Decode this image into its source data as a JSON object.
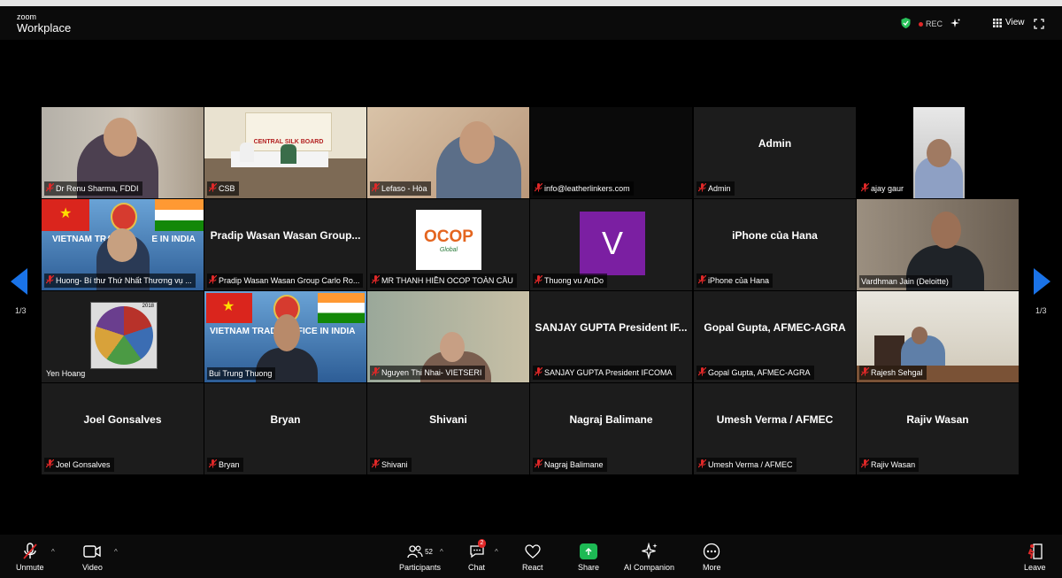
{
  "app": {
    "brand_small": "zoom",
    "brand_name": "Workplace"
  },
  "header": {
    "rec_label": "REC",
    "view_label": "View"
  },
  "pagination": {
    "left": "1/3",
    "right": "1/3"
  },
  "participants": [
    {
      "name": "Dr Renu Sharma, FDDI"
    },
    {
      "name": "CSB"
    },
    {
      "name": "Lefaso - Hòa"
    },
    {
      "name": "info@leatherlinkers.com"
    },
    {
      "name": "Admin",
      "center_label": "Admin"
    },
    {
      "name": "ajay gaur"
    },
    {
      "name": "Huong- Bí thư Thứ Nhất Thương vụ ..."
    },
    {
      "name": "Pradip Wasan Wasan Group Carlo Ro...",
      "center_label": "Pradip Wasan Wasan Group..."
    },
    {
      "name": "MR THANH HIỀN OCOP TOÀN CẦU"
    },
    {
      "name": "Thuong vu AnDo"
    },
    {
      "name": "iPhone của Hana",
      "center_label": "iPhone của Hana"
    },
    {
      "name": "Vardhman Jain (Deloitte)"
    },
    {
      "name": "Yen Hoang"
    },
    {
      "name": "Bui Trung Thuong"
    },
    {
      "name": "Nguyen Thi Nhai- VIETSERI"
    },
    {
      "name": "SANJAY GUPTA President IFCOMA",
      "center_label": "SANJAY GUPTA President IF..."
    },
    {
      "name": "Gopal Gupta, AFMEC-AGRA",
      "center_label": "Gopal Gupta, AFMEC-AGRA"
    },
    {
      "name": "Rajesh Sehgal"
    },
    {
      "name": "Joel Gonsalves",
      "center_label": "Joel Gonsalves"
    },
    {
      "name": "Bryan",
      "center_label": "Bryan"
    },
    {
      "name": "Shivani",
      "center_label": "Shivani"
    },
    {
      "name": "Nagraj Balimane",
      "center_label": "Nagraj Balimane"
    },
    {
      "name": "Umesh Verma / AFMEC",
      "center_label": "Umesh Verma / AFMEC"
    },
    {
      "name": "Rajiv Wasan",
      "center_label": "Rajiv Wasan"
    }
  ],
  "video_text": {
    "csb_banner": "CENTRAL SILK BOARD",
    "vn_banner": "VIETNAM TRADE OFFICE IN INDIA",
    "vn_banner_partial": "VIETNAM TRA",
    "vn_banner_partial2": "E IN INDIA",
    "ocop_logo": "OCOP",
    "ocop_sub": "Global",
    "avatar_letter": "V",
    "year_text": "2018"
  },
  "toolbar": {
    "unmute": "Unmute",
    "video": "Video",
    "participants": "Participants",
    "participants_count": "52",
    "chat": "Chat",
    "chat_badge": "2",
    "react": "React",
    "share": "Share",
    "ai_companion": "AI Companion",
    "more": "More",
    "leave": "Leave"
  },
  "colors": {
    "background": "#000000",
    "tile": "#1c1c1c",
    "speaking_border": "#3fbf4b",
    "nav_arrow": "#1a73e8",
    "share_green": "#1db954",
    "muted_red": "#e02828"
  }
}
